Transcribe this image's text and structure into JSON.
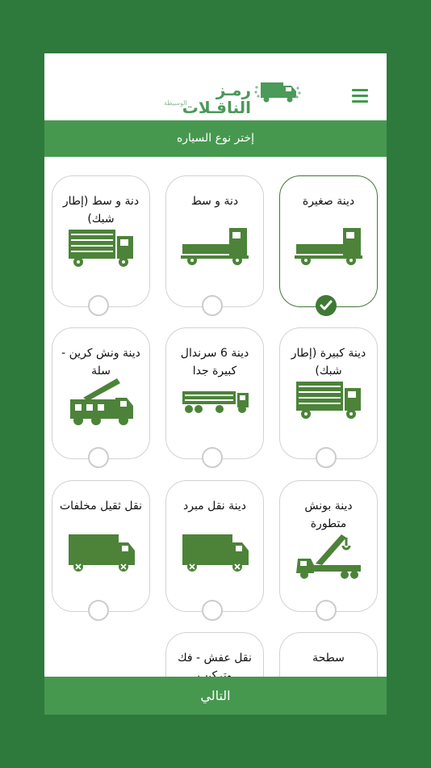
{
  "header": {
    "logo_name": "رمـز الناقـلات",
    "logo_subtitle": "الوسيطة"
  },
  "title_bar": "إختر نوع السياره",
  "vehicles": [
    {
      "label": "دينة صغيرة",
      "selected": true
    },
    {
      "label": "دنة و سط",
      "selected": false
    },
    {
      "label": "دنة و سط (إطار شبك)",
      "selected": false
    },
    {
      "label": "دينة كبيرة (إطار شبك)",
      "selected": false
    },
    {
      "label": "دينة 6 سرندال كبيرة جدا",
      "selected": false
    },
    {
      "label": "دينة ونش كرين - سلة",
      "selected": false
    },
    {
      "label": "دينة بونش متطورة",
      "selected": false
    },
    {
      "label": "دينة نقل مبرد",
      "selected": false
    },
    {
      "label": "نقل ثقيل مخلفات",
      "selected": false
    },
    {
      "label": "سطحة",
      "selected": false
    },
    {
      "label": "نقل عفش - فك وتركيب",
      "selected": false
    }
  ],
  "next_button": "التالي",
  "colors": {
    "primary": "#46984f",
    "truck": "#4c8339",
    "background": "#2e7a3c"
  }
}
